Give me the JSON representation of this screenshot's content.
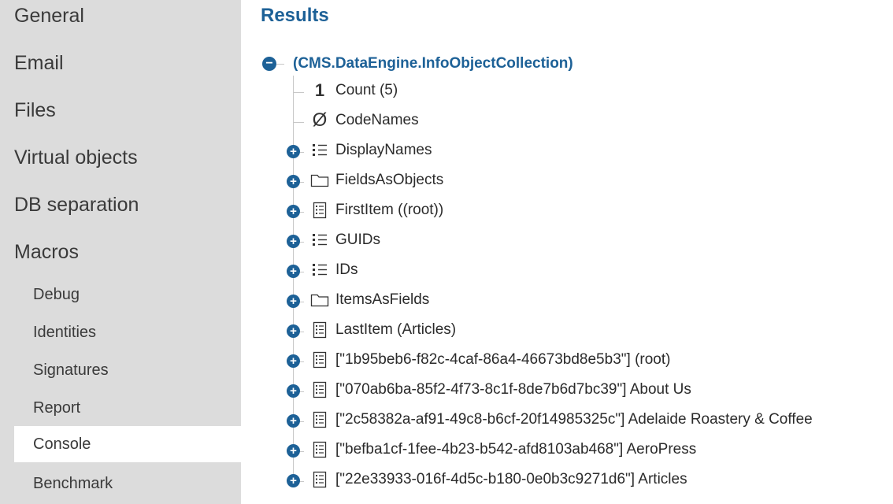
{
  "sidebar": {
    "items": [
      {
        "label": "General"
      },
      {
        "label": "Email"
      },
      {
        "label": "Files"
      },
      {
        "label": "Virtual objects"
      },
      {
        "label": "DB separation"
      },
      {
        "label": "Macros"
      }
    ],
    "subitems": [
      {
        "label": "Debug"
      },
      {
        "label": "Identities"
      },
      {
        "label": "Signatures"
      },
      {
        "label": "Report"
      },
      {
        "label": "Console",
        "active": true
      },
      {
        "label": "Benchmark"
      }
    ]
  },
  "main": {
    "title": "Results",
    "root": {
      "toggle": "−",
      "label": "(CMS.DataEngine.InfoObjectCollection)"
    },
    "rows": [
      {
        "icon": "number-one-icon",
        "icon_text": "1",
        "label": "Count (5)"
      },
      {
        "icon": "null-icon",
        "icon_text": "Ø",
        "label": "CodeNames"
      },
      {
        "icon": "list-icon",
        "toggle": "+",
        "label": "DisplayNames"
      },
      {
        "icon": "folder-icon",
        "toggle": "+",
        "label": "FieldsAsObjects"
      },
      {
        "icon": "document-icon",
        "toggle": "+",
        "label": "FirstItem ((root))"
      },
      {
        "icon": "list-icon",
        "toggle": "+",
        "label": "GUIDs"
      },
      {
        "icon": "list-icon",
        "toggle": "+",
        "label": "IDs"
      },
      {
        "icon": "folder-icon",
        "toggle": "+",
        "label": "ItemsAsFields"
      },
      {
        "icon": "document-icon",
        "toggle": "+",
        "label": "LastItem (Articles)"
      },
      {
        "icon": "document-icon",
        "toggle": "+",
        "label": "[\"1b95beb6-f82c-4caf-86a4-46673bd8e5b3\"] (root)"
      },
      {
        "icon": "document-icon",
        "toggle": "+",
        "label": "[\"070ab6ba-85f2-4f73-8c1f-8de7b6d7bc39\"] About Us"
      },
      {
        "icon": "document-icon",
        "toggle": "+",
        "label": "[\"2c58382a-af91-49c8-b6cf-20f14985325c\"] Adelaide Roastery & Coffee"
      },
      {
        "icon": "document-icon",
        "toggle": "+",
        "label": "[\"befba1cf-1fee-4b23-b542-afd8103ab468\"] AeroPress"
      },
      {
        "icon": "document-icon",
        "toggle": "+",
        "label": "[\"22e33933-016f-4d5c-b180-0e0b3c9271d6\"] Articles"
      }
    ]
  }
}
